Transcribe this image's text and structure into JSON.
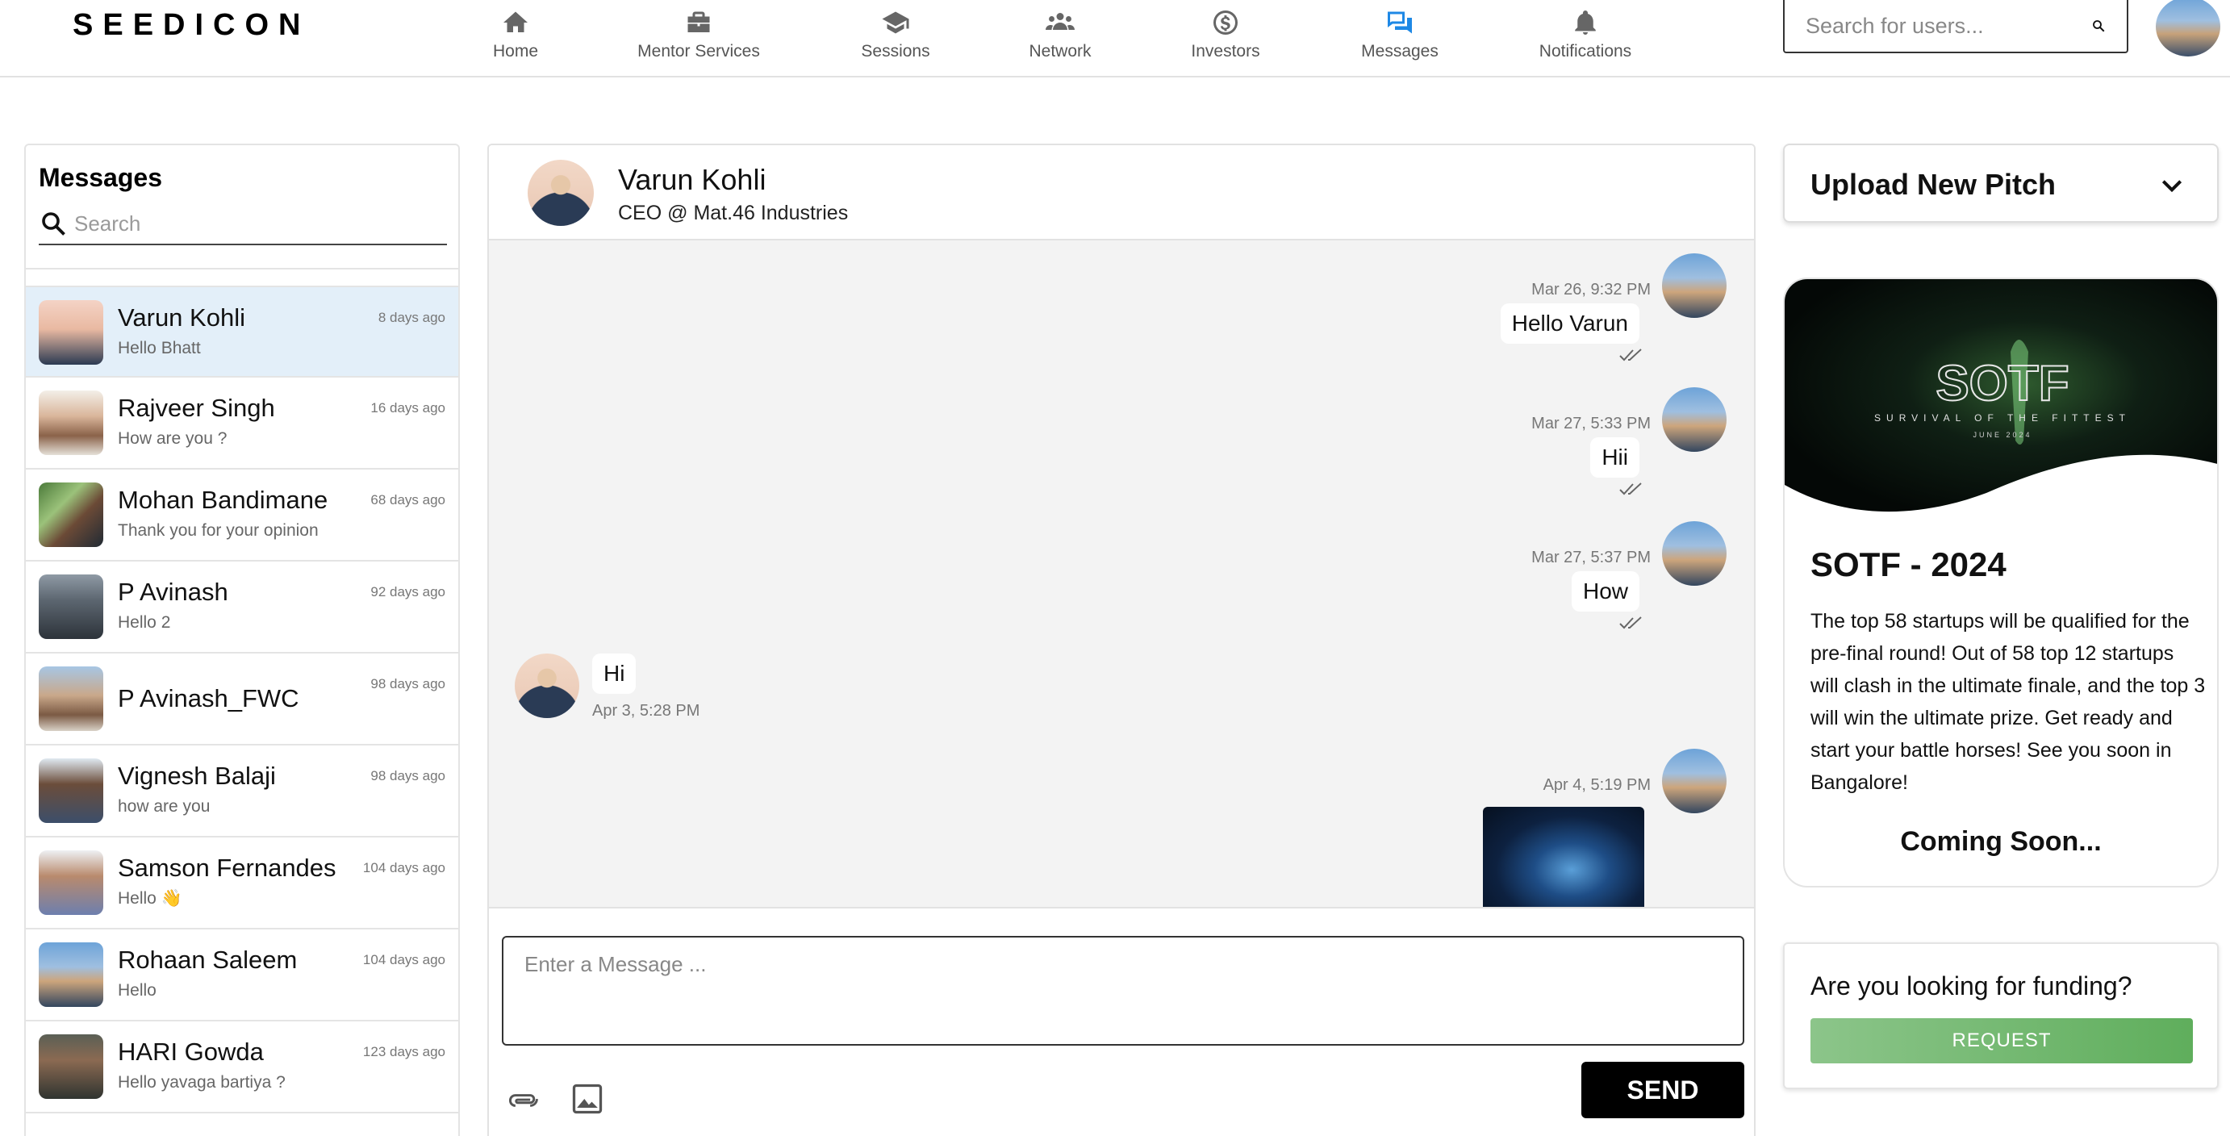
{
  "brand": {
    "logo": "SEEDICON"
  },
  "nav": [
    {
      "label": "Home",
      "icon": "home-icon"
    },
    {
      "label": "Mentor Services",
      "icon": "briefcase-icon"
    },
    {
      "label": "Sessions",
      "icon": "graduation-cap-icon"
    },
    {
      "label": "Network",
      "icon": "people-icon"
    },
    {
      "label": "Investors",
      "icon": "dollar-circle-icon"
    },
    {
      "label": "Messages",
      "icon": "chat-icon",
      "active": true
    },
    {
      "label": "Notifications",
      "icon": "bell-icon"
    }
  ],
  "header_search": {
    "placeholder": "Search for users..."
  },
  "messages_panel": {
    "title": "Messages",
    "search_placeholder": "Search",
    "conversations": [
      {
        "name": "Varun Kohli",
        "preview": "Hello Bhatt",
        "time": "8 days ago",
        "selected": true
      },
      {
        "name": "Rajveer Singh",
        "preview": "How are you ?",
        "time": "16 days ago"
      },
      {
        "name": "Mohan Bandimane",
        "preview": "Thank you for your opinion",
        "time": "68 days ago"
      },
      {
        "name": "P Avinash",
        "preview": "Hello 2",
        "time": "92 days ago"
      },
      {
        "name": "P Avinash_FWC",
        "preview": "",
        "time": "98 days ago"
      },
      {
        "name": "Vignesh Balaji",
        "preview": "how are you",
        "time": "98 days ago"
      },
      {
        "name": "Samson Fernandes",
        "preview": "Hello 👋",
        "time": "104 days ago"
      },
      {
        "name": "Rohaan Saleem",
        "preview": "Hello",
        "time": "104 days ago"
      },
      {
        "name": "HARI Gowda",
        "preview": "Hello yavaga bartiya ?",
        "time": "123 days ago"
      }
    ]
  },
  "chat": {
    "contact_name": "Varun Kohli",
    "contact_role": "CEO @ Mat.46 Industries",
    "messages": [
      {
        "from": "me",
        "text": "Hello Varun",
        "time": "Mar 26, 9:32 PM"
      },
      {
        "from": "me",
        "text": "Hii",
        "time": "Mar 27, 5:33 PM"
      },
      {
        "from": "me",
        "text": "How",
        "time": "Mar 27, 5:37 PM"
      },
      {
        "from": "them",
        "text": "Hi",
        "time": "Apr 3, 5:28 PM"
      },
      {
        "from": "me",
        "text": "",
        "time": "Apr 4, 5:19 PM",
        "type": "image"
      }
    ],
    "input_placeholder": "Enter a Message ...",
    "send_label": "SEND"
  },
  "upload_pitch": {
    "label": "Upload New Pitch"
  },
  "event": {
    "banner_title": "SOTF",
    "banner_subtitle": "SURVIVAL OF THE FITTEST",
    "banner_date": "JUNE 2024",
    "title": "SOTF - 2024",
    "description": "The top 58 startups will be qualified for the pre-final round! Out of 58 top 12 startups will clash in the ultimate finale, and the top 3 will win the ultimate prize. Get ready and start your battle horses! See you soon in Bangalore!",
    "status": "Coming Soon..."
  },
  "funding": {
    "question": "Are you looking for funding?",
    "button_label": "REQUEST"
  },
  "colors": {
    "accent": "#1e88e5",
    "selected_row": "#e3eff9",
    "request_green": "#6cb869",
    "chat_bg": "#f3f3f3"
  }
}
